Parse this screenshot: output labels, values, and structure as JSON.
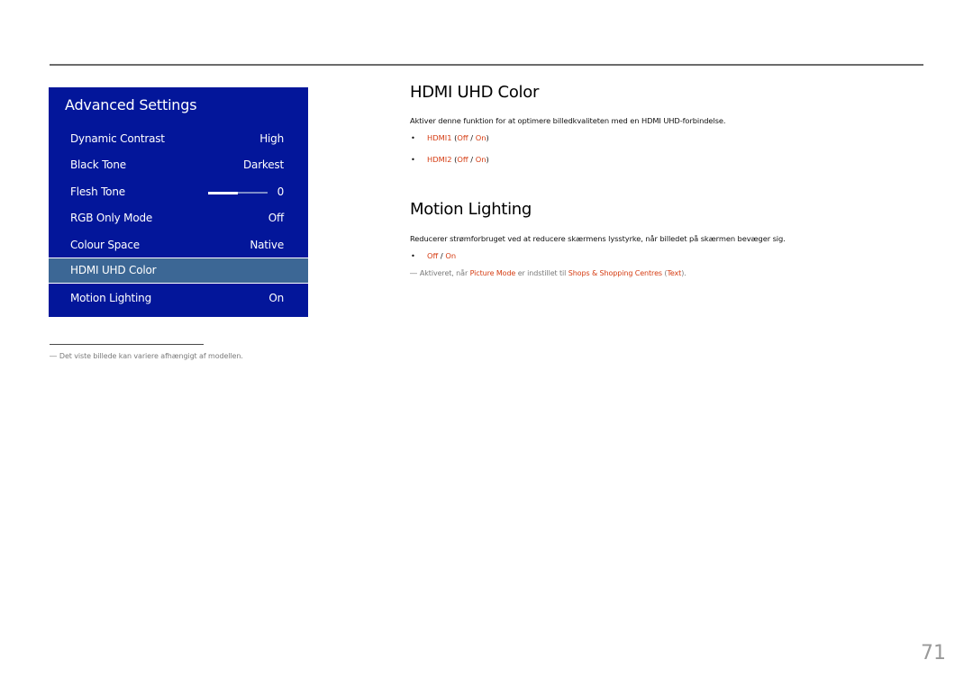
{
  "menu": {
    "title": "Advanced Settings",
    "items": [
      {
        "label": "Dynamic Contrast",
        "value": "High"
      },
      {
        "label": "Black Tone",
        "value": "Darkest"
      },
      {
        "label": "Flesh Tone",
        "value": "0",
        "slider_fill_percent": 50
      },
      {
        "label": "RGB Only Mode",
        "value": "Off"
      },
      {
        "label": "Colour Space",
        "value": "Native"
      },
      {
        "label": "HDMI UHD Color",
        "value": "",
        "selected": true
      },
      {
        "label": "Motion Lighting",
        "value": "On"
      }
    ],
    "colors": {
      "panel_bg": "#03169a",
      "selected_bg": "#3c6795"
    }
  },
  "sections": {
    "hdmi_uhd": {
      "heading": "HDMI UHD Color",
      "description": "Aktiver denne funktion for at optimere billedkvaliteten med en HDMI UHD-forbindelse.",
      "bullets": [
        {
          "name": "HDMI1",
          "open": " (",
          "off": "Off",
          "sep": " / ",
          "on": "On",
          "close": ")"
        },
        {
          "name": "HDMI2",
          "open": " (",
          "off": "Off",
          "sep": " / ",
          "on": "On",
          "close": ")"
        }
      ]
    },
    "motion_lighting": {
      "heading": "Motion Lighting",
      "description": "Reducerer strømforbruget ved at reducere skærmens lysstyrke, når billedet på skærmen bevæger sig.",
      "bullet": {
        "off": "Off",
        "sep": " / ",
        "on": "On"
      },
      "note": {
        "dash": "―",
        "t1": "Aktiveret, når ",
        "picture_mode": "Picture Mode",
        "t2": " er indstillet til ",
        "shops": "Shops & Shopping Centres",
        "t3": " (",
        "text": "Text",
        "t4": ")."
      }
    }
  },
  "footnote": {
    "dash": "―",
    "text": "Det viste billede kan variere afhængigt af modellen."
  },
  "page_number": "71",
  "accent_color": "#d53c12"
}
